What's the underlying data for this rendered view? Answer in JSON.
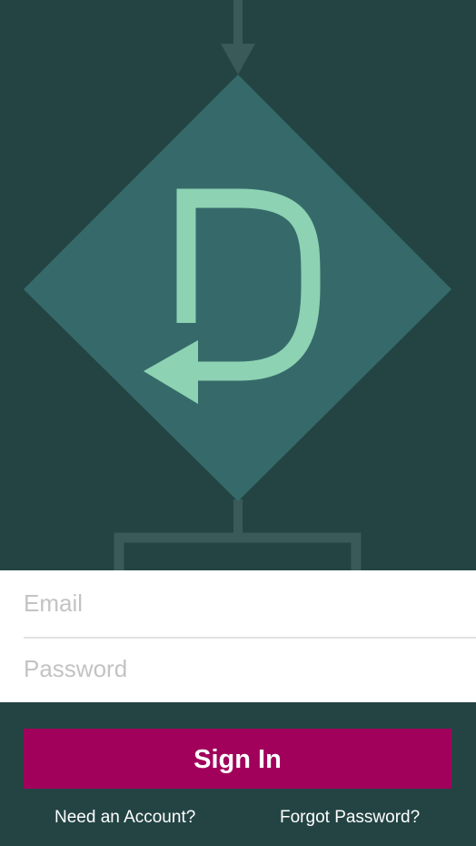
{
  "hero": {
    "logo_icon": "loop-arrow-d-logo-icon",
    "colors": {
      "background": "#244444",
      "diamond": "#366a6a",
      "connector": "#3a5959",
      "logo": "#8dd2b3"
    }
  },
  "form": {
    "email": {
      "placeholder": "Email",
      "value": ""
    },
    "password": {
      "placeholder": "Password",
      "value": ""
    }
  },
  "actions": {
    "sign_in_label": "Sign In",
    "sign_in_color": "#a1005b",
    "need_account_label": "Need an Account?",
    "forgot_password_label": "Forgot Password?"
  }
}
